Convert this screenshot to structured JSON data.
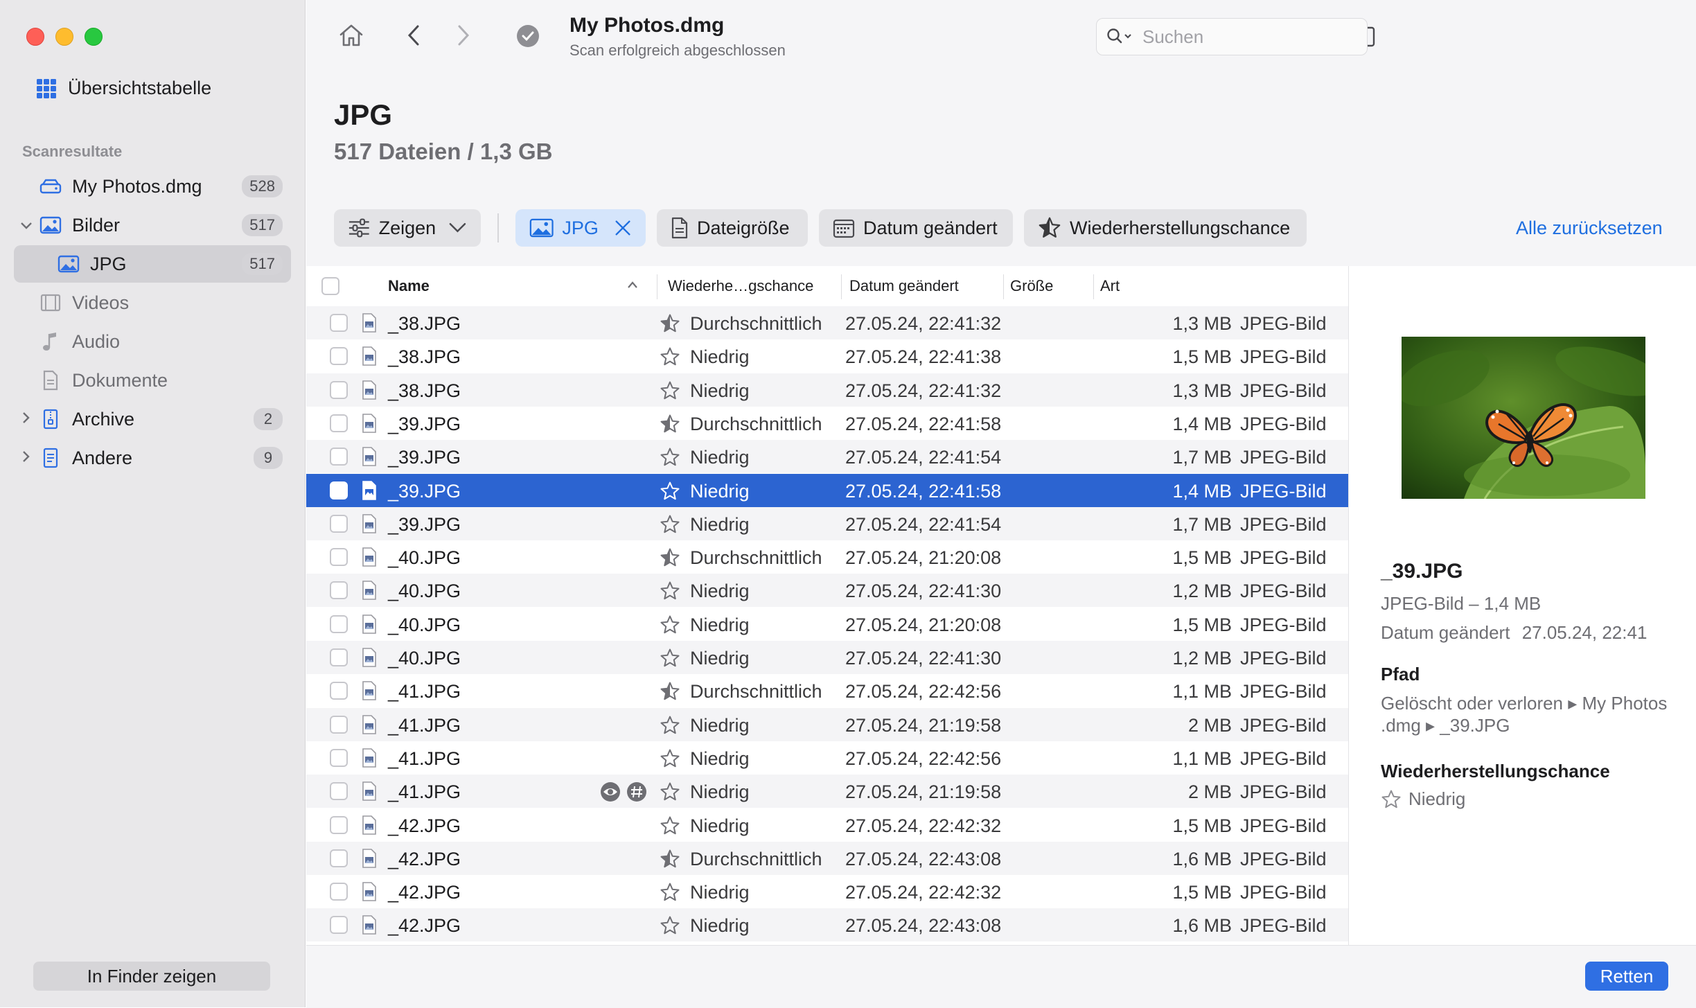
{
  "window": {
    "title": "My Photos.dmg",
    "subtitle": "Scan erfolgreich abgeschlossen"
  },
  "sidebar": {
    "overview_label": "Übersichtstabelle",
    "section_label": "Scanresultate",
    "items": [
      {
        "label": "My Photos.dmg",
        "badge": "528"
      },
      {
        "label": "Bilder",
        "badge": "517"
      },
      {
        "label": "JPG",
        "badge": "517"
      },
      {
        "label": "Videos"
      },
      {
        "label": "Audio"
      },
      {
        "label": "Dokumente"
      },
      {
        "label": "Archive",
        "badge": "2"
      },
      {
        "label": "Andere",
        "badge": "9"
      }
    ],
    "finder_button": "In Finder zeigen"
  },
  "search": {
    "placeholder": "Suchen"
  },
  "header": {
    "title": "JPG",
    "subtitle": "517 Dateien / 1,3 GB"
  },
  "filters": {
    "show_label": "Zeigen",
    "jpg_label": "JPG",
    "size_label": "Dateigröße",
    "date_label": "Datum geändert",
    "chance_label": "Wiederherstellungschance",
    "reset_label": "Alle zurücksetzen"
  },
  "table": {
    "columns": {
      "name": "Name",
      "chance": "Wiederhe…gschance",
      "date": "Datum geändert",
      "size": "Größe",
      "kind": "Art"
    },
    "rows": [
      {
        "name": "_38.JPG",
        "chance": "Durchschnittlich",
        "date": "27.05.24, 22:41:32",
        "size": "1,3 MB",
        "kind": "JPEG-Bild"
      },
      {
        "name": "_38.JPG",
        "chance": "Niedrig",
        "date": "27.05.24, 22:41:38",
        "size": "1,5 MB",
        "kind": "JPEG-Bild"
      },
      {
        "name": "_38.JPG",
        "chance": "Niedrig",
        "date": "27.05.24, 22:41:32",
        "size": "1,3 MB",
        "kind": "JPEG-Bild"
      },
      {
        "name": "_39.JPG",
        "chance": "Durchschnittlich",
        "date": "27.05.24, 22:41:58",
        "size": "1,4 MB",
        "kind": "JPEG-Bild"
      },
      {
        "name": "_39.JPG",
        "chance": "Niedrig",
        "date": "27.05.24, 22:41:54",
        "size": "1,7 MB",
        "kind": "JPEG-Bild"
      },
      {
        "name": "_39.JPG",
        "chance": "Niedrig",
        "date": "27.05.24, 22:41:58",
        "size": "1,4 MB",
        "kind": "JPEG-Bild",
        "selected": true
      },
      {
        "name": "_39.JPG",
        "chance": "Niedrig",
        "date": "27.05.24, 22:41:54",
        "size": "1,7 MB",
        "kind": "JPEG-Bild"
      },
      {
        "name": "_40.JPG",
        "chance": "Durchschnittlich",
        "date": "27.05.24, 21:20:08",
        "size": "1,5 MB",
        "kind": "JPEG-Bild"
      },
      {
        "name": "_40.JPG",
        "chance": "Niedrig",
        "date": "27.05.24, 22:41:30",
        "size": "1,2 MB",
        "kind": "JPEG-Bild"
      },
      {
        "name": "_40.JPG",
        "chance": "Niedrig",
        "date": "27.05.24, 21:20:08",
        "size": "1,5 MB",
        "kind": "JPEG-Bild"
      },
      {
        "name": "_40.JPG",
        "chance": "Niedrig",
        "date": "27.05.24, 22:41:30",
        "size": "1,2 MB",
        "kind": "JPEG-Bild"
      },
      {
        "name": "_41.JPG",
        "chance": "Durchschnittlich",
        "date": "27.05.24, 22:42:56",
        "size": "1,1 MB",
        "kind": "JPEG-Bild"
      },
      {
        "name": "_41.JPG",
        "chance": "Niedrig",
        "date": "27.05.24, 21:19:58",
        "size": "2 MB",
        "kind": "JPEG-Bild"
      },
      {
        "name": "_41.JPG",
        "chance": "Niedrig",
        "date": "27.05.24, 22:42:56",
        "size": "1,1 MB",
        "kind": "JPEG-Bild"
      },
      {
        "name": "_41.JPG",
        "chance": "Niedrig",
        "date": "27.05.24, 21:19:58",
        "size": "2 MB",
        "kind": "JPEG-Bild",
        "hover_icons": true
      },
      {
        "name": "_42.JPG",
        "chance": "Niedrig",
        "date": "27.05.24, 22:42:32",
        "size": "1,5 MB",
        "kind": "JPEG-Bild"
      },
      {
        "name": "_42.JPG",
        "chance": "Durchschnittlich",
        "date": "27.05.24, 22:43:08",
        "size": "1,6 MB",
        "kind": "JPEG-Bild"
      },
      {
        "name": "_42.JPG",
        "chance": "Niedrig",
        "date": "27.05.24, 22:42:32",
        "size": "1,5 MB",
        "kind": "JPEG-Bild"
      },
      {
        "name": "_42.JPG",
        "chance": "Niedrig",
        "date": "27.05.24, 22:43:08",
        "size": "1,6 MB",
        "kind": "JPEG-Bild"
      }
    ]
  },
  "preview": {
    "filename": "_39.JPG",
    "type_size": "JPEG-Bild – 1,4 MB",
    "date_label": "Datum geändert",
    "date_value": "27.05.24, 22:41",
    "path_heading": "Pfad",
    "path_line1": "Gelöscht oder verloren ▸ My Photos",
    "path_line2": ".dmg ▸ _39.JPG",
    "chance_heading": "Wiederherstellungschance",
    "chance_value": "Niedrig"
  },
  "footer": {
    "recover_button": "Retten"
  },
  "colors": {
    "accent": "#2f6fe3",
    "selection": "#2c64d1"
  }
}
